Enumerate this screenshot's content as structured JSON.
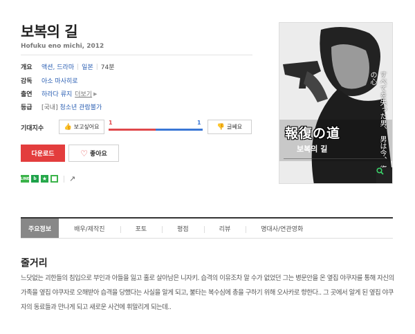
{
  "movie": {
    "title": "보복의 길",
    "subtitle": "Hofuku eno michi, 2012"
  },
  "info": {
    "overview_label": "개요",
    "genres": [
      "액션, 드라마",
      "일본"
    ],
    "runtime": "74분",
    "director_label": "감독",
    "director": "아소 마사히로",
    "cast_label": "출연",
    "cast": "하라다 류지",
    "more_label": "더보기",
    "rating_label": "등급",
    "rating_prefix": "[국내]",
    "rating": "청소년 관람불가"
  },
  "expectation": {
    "label": "기대지수",
    "help": "?",
    "want_label": "보고싶어요",
    "want_count": "1",
    "meh_count": "1",
    "meh_label": "글쎄요",
    "want_ratio": 0.5,
    "colors": {
      "want": "#e0484b",
      "meh": "#3a77d6"
    }
  },
  "actions": {
    "download_label": "다운로드",
    "like_label": "좋아요"
  },
  "share": {
    "icons": [
      "line-icon",
      "band-icon",
      "star-icon",
      "box-icon",
      "share-icon"
    ],
    "line_text": "LINE"
  },
  "poster": {
    "title_jp": "報復の道",
    "title_kr": "보복의 길",
    "tagline_jp": "すべてを失った男、 男は今、 復讐の心"
  },
  "tabs": [
    {
      "label": "주요정보",
      "active": true
    },
    {
      "label": "배우/제작진",
      "active": false
    },
    {
      "label": "포토",
      "active": false
    },
    {
      "label": "평점",
      "active": false
    },
    {
      "label": "리뷰",
      "active": false
    },
    {
      "label": "명대사/연관영화",
      "active": false
    }
  ],
  "synopsis": {
    "heading": "줄거리",
    "text": "느닷없는 괴한들의 침입으로 부인과 아들을 잃고 홀로 살아남은 니자키. 습격의 이유조차 알 수가 없었던 그는 병문안을 온 옆집 야쿠자를 통해 자신의 가족을 옆집 야쿠자로 오해받아 습격을 당했다는 사실을 알게 되고, 불타는 복수심에 총을 구하기 위해 오사카로 향한다.. 그 곳에서 알게 된 옆집 야쿠자의 동료들과 만나게 되고 새로운 사건에 휘말리게 되는데.."
  }
}
